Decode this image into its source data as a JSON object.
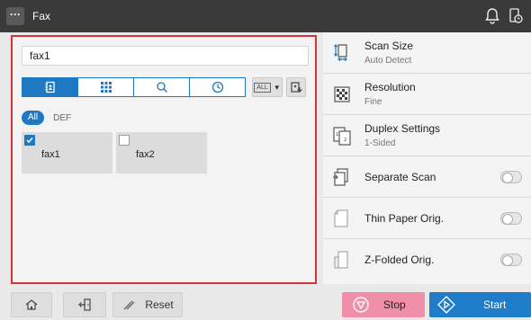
{
  "header": {
    "menu_label": "···",
    "title": "Fax",
    "icons": [
      "bell-icon",
      "device-status-icon"
    ]
  },
  "destination": {
    "address_value": "fax1",
    "tabs": [
      {
        "name": "address-book-tab",
        "icon": "address-book-icon",
        "active": true
      },
      {
        "name": "group-tab",
        "icon": "grid-icon",
        "active": false
      },
      {
        "name": "search-tab",
        "icon": "search-icon",
        "active": false
      },
      {
        "name": "history-tab",
        "icon": "clock-icon",
        "active": false
      }
    ],
    "sort_label": "ALL",
    "index": {
      "all": "All",
      "def": "DEF"
    },
    "entries": [
      {
        "name": "fax1",
        "checked": true
      },
      {
        "name": "fax2",
        "checked": false
      }
    ]
  },
  "settings": [
    {
      "title": "Scan Size",
      "value": "Auto Detect",
      "icon": "scan-size-icon"
    },
    {
      "title": "Resolution",
      "value": "Fine",
      "icon": "resolution-icon"
    },
    {
      "title": "Duplex Settings",
      "value": "1-Sided",
      "icon": "duplex-icon"
    },
    {
      "title": "Separate Scan",
      "toggle": false,
      "icon": "separate-scan-icon"
    },
    {
      "title": "Thin Paper Orig.",
      "toggle": false,
      "icon": "thin-paper-icon"
    },
    {
      "title": "Z-Folded Orig.",
      "toggle": false,
      "icon": "z-folded-icon"
    }
  ],
  "footer": {
    "reset_label": "Reset",
    "stop_label": "Stop",
    "start_label": "Start"
  },
  "colors": {
    "accent": "#1e78c2",
    "highlight_border": "#d9313b",
    "stop": "#ef8fa8",
    "start": "#1e7cc8"
  }
}
